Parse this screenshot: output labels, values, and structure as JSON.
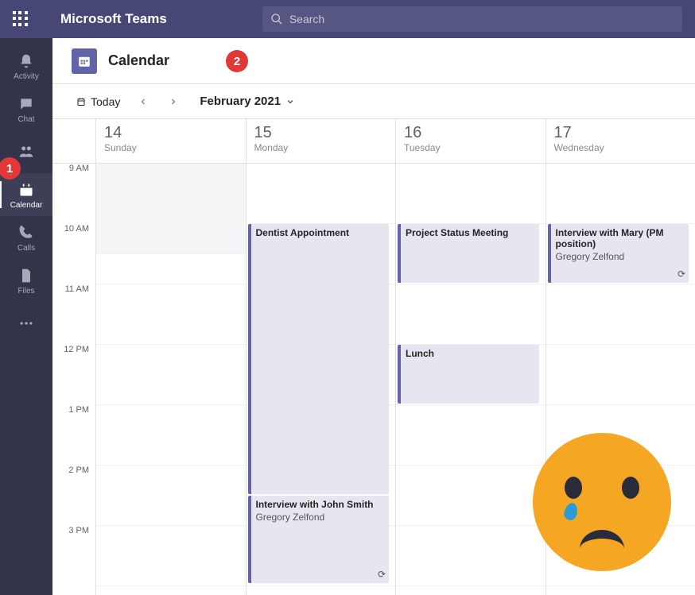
{
  "brand": "Microsoft Teams",
  "search": {
    "placeholder": "Search"
  },
  "rail": {
    "items": [
      {
        "label": "Activity"
      },
      {
        "label": "Chat"
      },
      {
        "label": "Teams"
      },
      {
        "label": "Calendar"
      },
      {
        "label": "Calls"
      },
      {
        "label": "Files"
      }
    ]
  },
  "annotations": {
    "one": "1",
    "two": "2"
  },
  "header": {
    "title": "Calendar"
  },
  "toolbar": {
    "today": "Today",
    "month": "February 2021"
  },
  "days": [
    {
      "num": "14",
      "name": "Sunday"
    },
    {
      "num": "15",
      "name": "Monday"
    },
    {
      "num": "16",
      "name": "Tuesday"
    },
    {
      "num": "17",
      "name": "Wednesday"
    }
  ],
  "hours": [
    "9 AM",
    "10 AM",
    "11 AM",
    "12 PM",
    "1 PM",
    "2 PM",
    "3 PM"
  ],
  "events": {
    "dentist": {
      "title": "Dentist Appointment"
    },
    "status": {
      "title": "Project Status Meeting"
    },
    "interview_mary": {
      "title": "Interview with Mary (PM position)",
      "subtitle": "Gregory Zelfond"
    },
    "lunch": {
      "title": "Lunch"
    },
    "interview_john": {
      "title": "Interview with John Smith",
      "subtitle": "Gregory Zelfond"
    }
  }
}
